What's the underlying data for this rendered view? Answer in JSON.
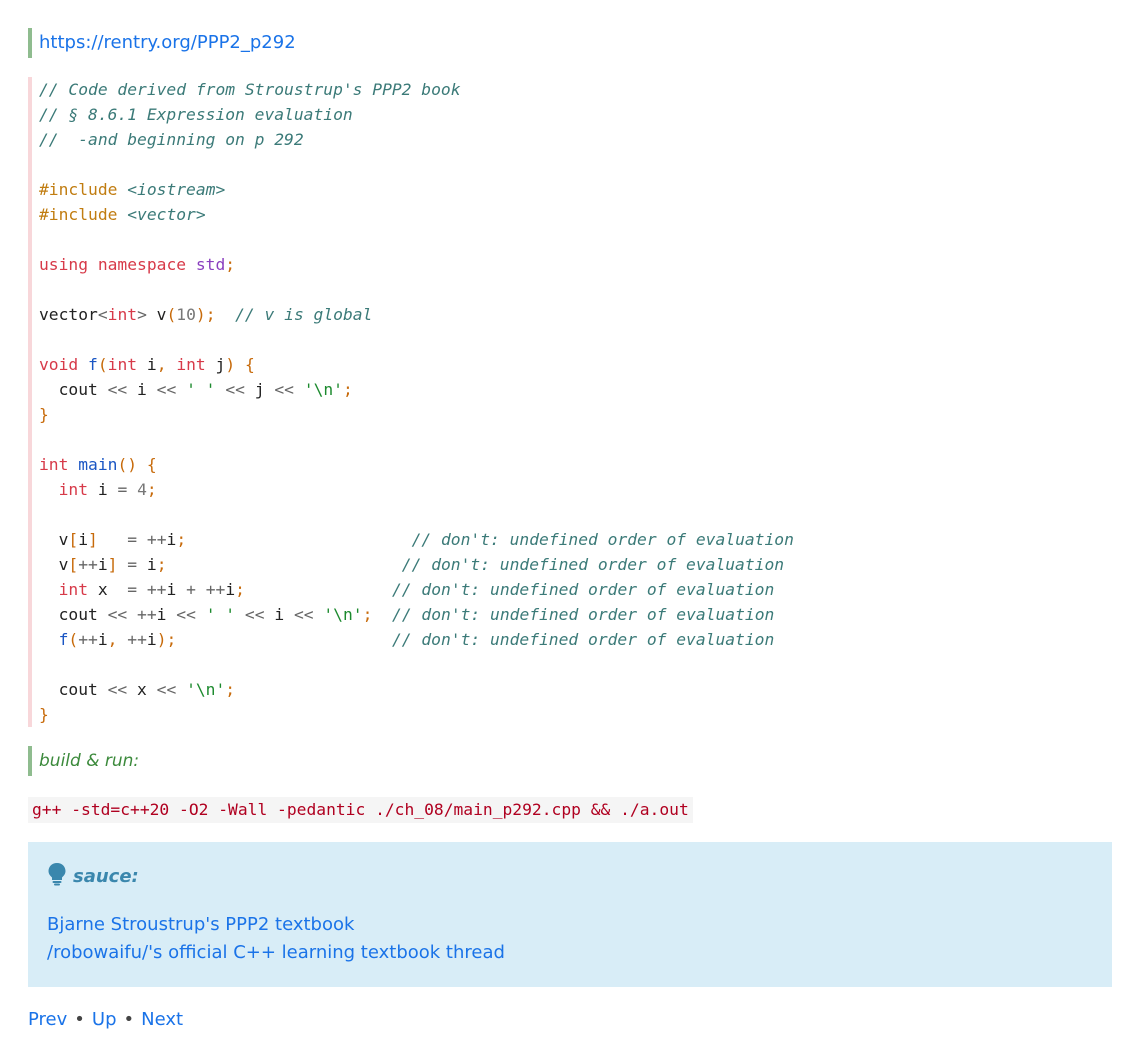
{
  "top_link": "https://rentry.org/PPP2_p292",
  "code": {
    "c1": "// Code derived from Stroustrup's PPP2 book",
    "c2": "// § 8.6.1 Expression evaluation",
    "c3": "//  -and beginning on p 292",
    "inc1": "<iostream>",
    "inc2": "<vector>",
    "global_comment": "// v is global",
    "ub_comment": "// don't: undefined order of evaluation"
  },
  "build_label": "build & run:",
  "build_command": "g++ -std=c++20 -O2 -Wall -pedantic ./ch_08/main_p292.cpp && ./a.out",
  "note": {
    "title": "sauce:",
    "icon": "lightbulb-icon",
    "links": [
      "Bjarne Stroustrup's PPP2 textbook",
      "/robowaifu/'s official C++ learning textbook thread"
    ]
  },
  "nav": {
    "prev": "Prev",
    "up": "Up",
    "next": "Next",
    "separator": "•"
  },
  "colors": {
    "link": "#1a73e8",
    "quote_bar": "#8fbc8f",
    "code_bar": "#f8d7da",
    "note_bg": "#d8edf7",
    "note_title": "#3a87ad"
  }
}
